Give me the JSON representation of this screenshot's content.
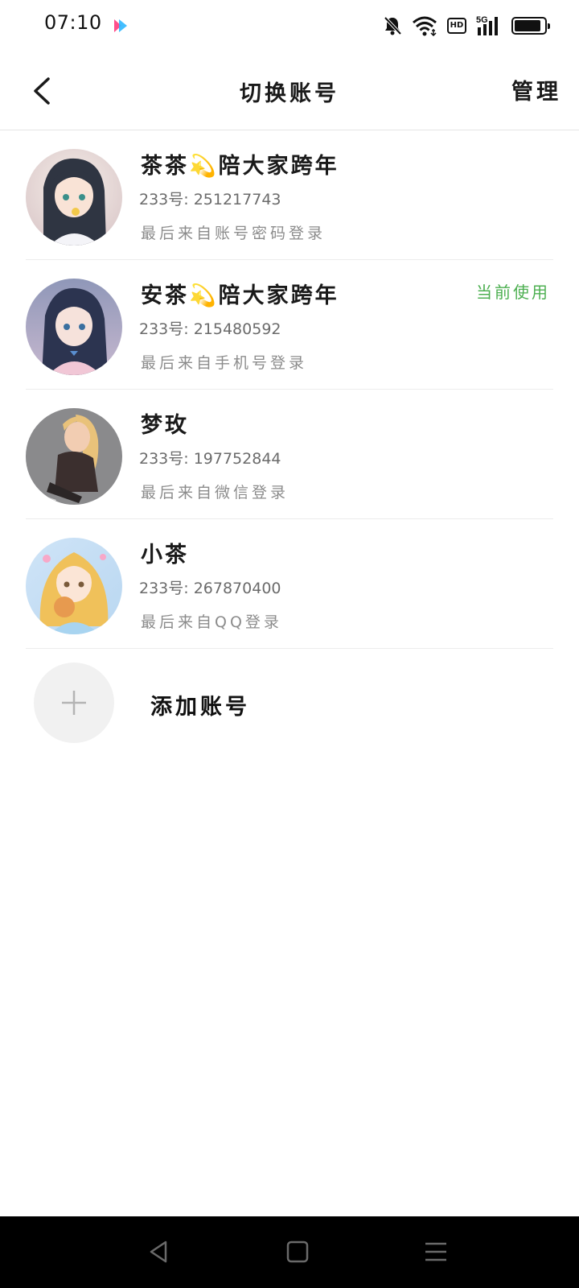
{
  "status_bar": {
    "time": "07:10",
    "network_label": "5G",
    "hd_label": "HD",
    "battery_level": 0.9,
    "icons": [
      "app-logo-icon",
      "mute-bell-icon",
      "wifi-icon",
      "hd-icon",
      "signal-icon",
      "battery-icon"
    ]
  },
  "header": {
    "title": "切换账号",
    "manage_label": "管理",
    "back_icon": "chevron-left-icon"
  },
  "accounts": [
    {
      "name": "茶茶💫陪大家跨年",
      "id_text": "233号: 251217743",
      "login_text": "最后来自账号密码登录",
      "current_label": ""
    },
    {
      "name": "安茶💫陪大家跨年",
      "id_text": "233号: 215480592",
      "login_text": "最后来自手机号登录",
      "current_label": "当前使用"
    },
    {
      "name": "梦玫",
      "id_text": "233号: 197752844",
      "login_text": "最后来自微信登录",
      "current_label": ""
    },
    {
      "name": "小茶",
      "id_text": "233号: 267870400",
      "login_text": "最后来自QQ登录",
      "current_label": ""
    }
  ],
  "add_account": {
    "label": "添加账号",
    "icon": "plus-icon"
  },
  "nav_bar": {
    "icons": [
      "back-triangle-icon",
      "home-square-icon",
      "menu-lines-icon"
    ]
  },
  "colors": {
    "current_accent": "#4caf50",
    "background": "#ffffff",
    "nav_background": "#000000"
  }
}
